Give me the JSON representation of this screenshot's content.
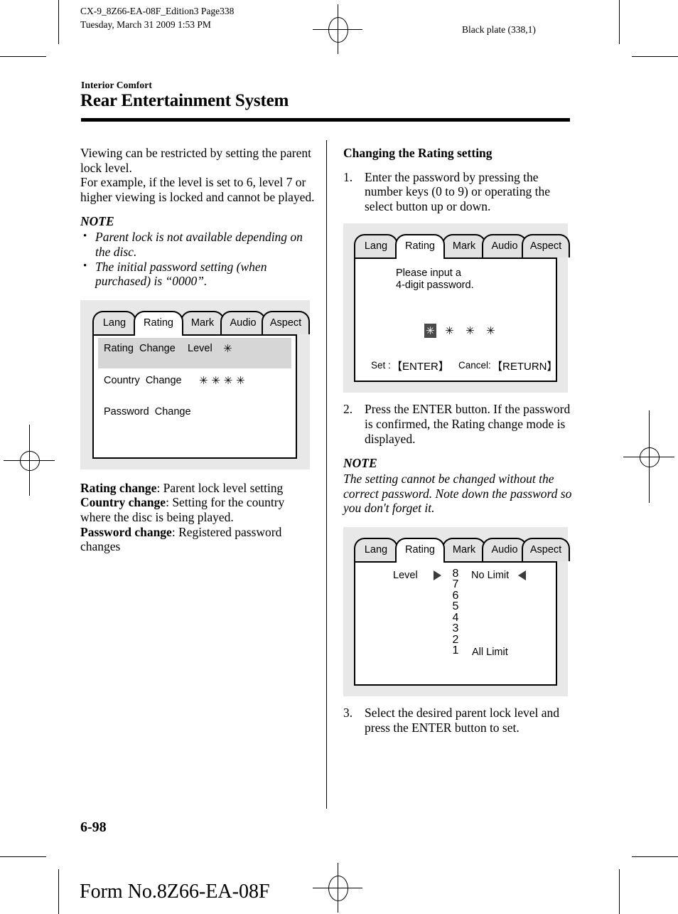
{
  "print_header": {
    "job_line1": "CX-9_8Z66-EA-08F_Edition3 Page338",
    "job_line2": "Tuesday, March 31 2009 1:53 PM",
    "plate": "Black plate (338,1)"
  },
  "section": {
    "eyebrow": "Interior Comfort",
    "title": "Rear Entertainment System"
  },
  "left_column": {
    "intro_p1": "Viewing can be restricted by setting the parent lock level.",
    "intro_p2": "For example, if the level is set to 6, level 7 or higher viewing is locked and cannot be played.",
    "note_heading": "NOTE",
    "note_items": [
      "Parent lock is not available depending on the disc.",
      "The initial password setting (when purchased) is “0000”."
    ],
    "definitions": [
      {
        "term": "Rating change",
        "text": ": Parent lock level setting"
      },
      {
        "term": "Country change",
        "text": ": Setting for the country where the disc is being played."
      },
      {
        "term": "Password change",
        "text": ": Registered password changes"
      }
    ]
  },
  "right_column": {
    "subheading": "Changing the Rating setting",
    "step1": {
      "num": "1.",
      "text": "Enter the password by pressing the number keys (0 to 9) or operating the select button up or down."
    },
    "step2": {
      "num": "2.",
      "text": "Press the ENTER button. If the password is confirmed, the Rating change mode is displayed."
    },
    "note_heading": "NOTE",
    "note_body": "The setting cannot be changed without the correct password. Note down the password so you don't forget it.",
    "step3": {
      "num": "3.",
      "text": "Select the desired parent lock level and press the ENTER button to set."
    }
  },
  "tabs": {
    "labels": [
      "Lang",
      "Rating",
      "Mark",
      "Audio",
      "Aspect"
    ],
    "active": "Rating"
  },
  "figure_rating_menu": {
    "row1_label": "Rating  Change",
    "row1_value_label": "Level",
    "row1_value": "✳",
    "row2_label": "Country  Change",
    "row2_value": "✳ ✳ ✳ ✳",
    "row3_label": "Password  Change"
  },
  "figure_password": {
    "prompt_line1": "Please input a",
    "prompt_line2": "4-digit password.",
    "digit_selected": "✳",
    "digit2": "✳",
    "digit3": "✳",
    "digit4": "✳",
    "set_label": "Set :",
    "set_key": "【ENTER】",
    "cancel_label": "Cancel:",
    "cancel_key": "【RETURN】"
  },
  "figure_level": {
    "label": "Level",
    "levels": [
      "8",
      "7",
      "6",
      "5",
      "4",
      "3",
      "2",
      "1"
    ],
    "top_limit": "No Limit",
    "bottom_limit": "All Limit",
    "cursor_left": "▶",
    "cursor_right": "◀"
  },
  "footer": {
    "folio": "6-98",
    "form_no": "Form No.8Z66-EA-08F"
  }
}
